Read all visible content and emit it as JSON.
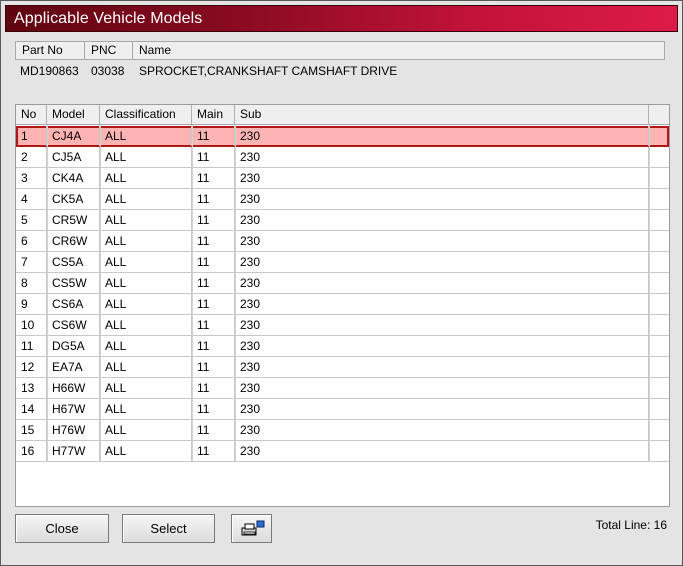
{
  "window": {
    "title": "Applicable Vehicle Models"
  },
  "part_info": {
    "headers": {
      "part_no": "Part No",
      "pnc": "PNC",
      "name": "Name"
    },
    "values": {
      "part_no": "MD190863",
      "pnc": "03038",
      "name": "SPROCKET,CRANKSHAFT CAMSHAFT DRIVE"
    }
  },
  "table": {
    "headers": {
      "no": "No",
      "model": "Model",
      "classification": "Classification",
      "main": "Main",
      "sub": "Sub"
    },
    "selected_row": 0,
    "rows": [
      {
        "no": "1",
        "model": "CJ4A",
        "classification": "ALL",
        "main": "11",
        "sub": "230"
      },
      {
        "no": "2",
        "model": "CJ5A",
        "classification": "ALL",
        "main": "11",
        "sub": "230"
      },
      {
        "no": "3",
        "model": "CK4A",
        "classification": "ALL",
        "main": "11",
        "sub": "230"
      },
      {
        "no": "4",
        "model": "CK5A",
        "classification": "ALL",
        "main": "11",
        "sub": "230"
      },
      {
        "no": "5",
        "model": "CR5W",
        "classification": "ALL",
        "main": "11",
        "sub": "230"
      },
      {
        "no": "6",
        "model": "CR6W",
        "classification": "ALL",
        "main": "11",
        "sub": "230"
      },
      {
        "no": "7",
        "model": "CS5A",
        "classification": "ALL",
        "main": "11",
        "sub": "230"
      },
      {
        "no": "8",
        "model": "CS5W",
        "classification": "ALL",
        "main": "11",
        "sub": "230"
      },
      {
        "no": "9",
        "model": "CS6A",
        "classification": "ALL",
        "main": "11",
        "sub": "230"
      },
      {
        "no": "10",
        "model": "CS6W",
        "classification": "ALL",
        "main": "11",
        "sub": "230"
      },
      {
        "no": "11",
        "model": "DG5A",
        "classification": "ALL",
        "main": "11",
        "sub": "230"
      },
      {
        "no": "12",
        "model": "EA7A",
        "classification": "ALL",
        "main": "11",
        "sub": "230"
      },
      {
        "no": "13",
        "model": "H66W",
        "classification": "ALL",
        "main": "11",
        "sub": "230"
      },
      {
        "no": "14",
        "model": "H67W",
        "classification": "ALL",
        "main": "11",
        "sub": "230"
      },
      {
        "no": "15",
        "model": "H76W",
        "classification": "ALL",
        "main": "11",
        "sub": "230"
      },
      {
        "no": "16",
        "model": "H77W",
        "classification": "ALL",
        "main": "11",
        "sub": "230"
      }
    ]
  },
  "footer": {
    "close_label": "Close",
    "select_label": "Select",
    "print_icon": "printer-icon",
    "total_label": "Total Line: 16"
  },
  "colors": {
    "title_gradient_start": "#5e0410",
    "title_gradient_end": "#dc1c48",
    "selected_row_bg": "#ffb4b4",
    "selected_row_border": "#b01818"
  }
}
